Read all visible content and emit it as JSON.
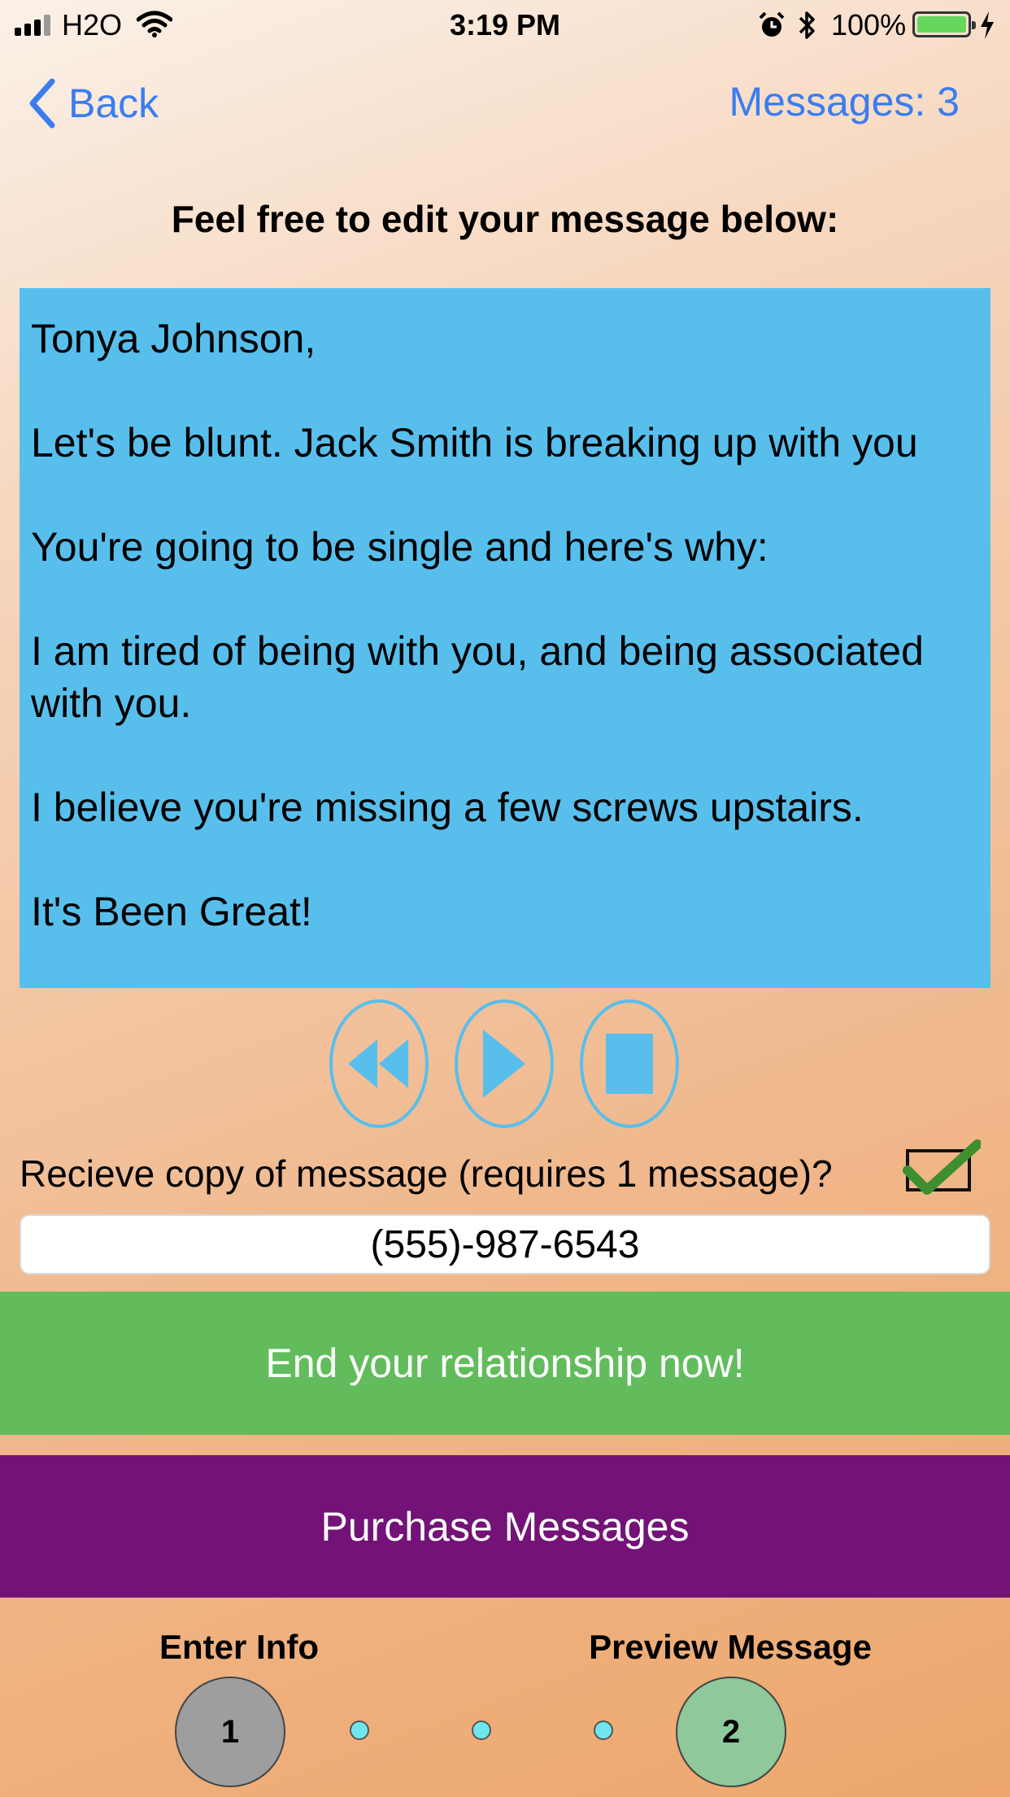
{
  "status_bar": {
    "carrier": "H2O",
    "time": "3:19 PM",
    "battery": "100%"
  },
  "nav": {
    "back_label": "Back",
    "messages_count": "Messages: 3"
  },
  "heading": "Feel free to edit your message below:",
  "message": {
    "text": "Tonya Johnson,\n\nLet's be blunt. Jack Smith is breaking up with you\n\nYou're going to be single and here's why:\n\nI am tired of being with you, and being associated with you.\n\nI believe you're missing a few screws upstairs.\n\nIt's Been Great!"
  },
  "copy_option": {
    "label": "Recieve copy of message (requires 1 message)?",
    "checked": true
  },
  "phone_field": {
    "value": "(555)-987-6543"
  },
  "buttons": {
    "end_label": "End your relationship now!",
    "purchase_label": "Purchase Messages"
  },
  "steps": {
    "step1_label": "Enter Info",
    "step1_number": "1",
    "step2_label": "Preview Message",
    "step2_number": "2"
  },
  "colors": {
    "accent_blue": "#3b7df0",
    "message_bg": "#58bfed",
    "end_button": "#62bc5c",
    "purchase_button": "#731277",
    "step1_circle": "#9e9e9e",
    "step2_circle": "#8fc89a"
  }
}
